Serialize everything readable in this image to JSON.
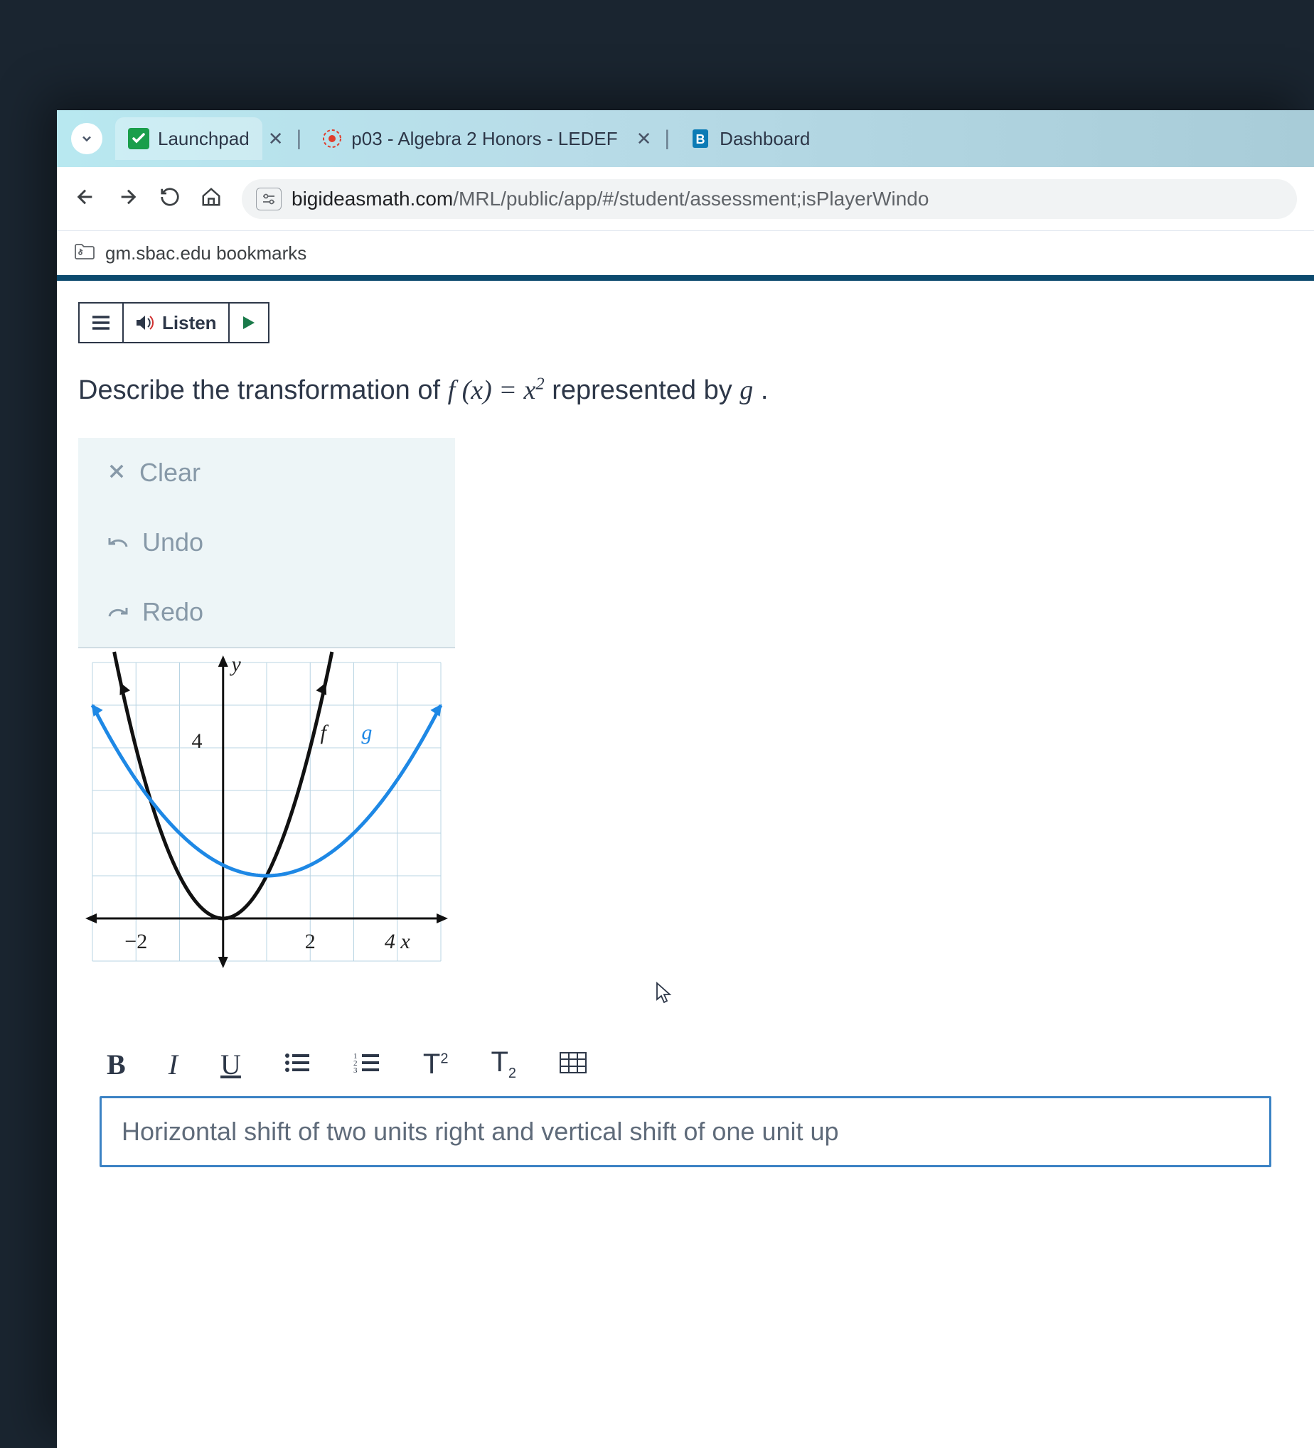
{
  "tabs": [
    {
      "title": "Launchpad",
      "favicon": "check-green"
    },
    {
      "title": "p03 - Algebra 2 Honors - LEDEF",
      "favicon": "canvas-red"
    },
    {
      "title": "Dashboard",
      "favicon": "bigideas-blue"
    }
  ],
  "url": {
    "host": "bigideasmath.com",
    "path": "/MRL/public/app/#/student/assessment;isPlayerWindo"
  },
  "bookmark": "gm.sbac.edu bookmarks",
  "listen_label": "Listen",
  "question": {
    "prefix": "Describe the transformation of ",
    "fx": "f (x) = x",
    "exp": "2",
    "mid": " represented by ",
    "g": "g",
    "suffix": " ."
  },
  "panel": {
    "clear": "Clear",
    "undo": "Undo",
    "redo": "Redo"
  },
  "chart_data": {
    "type": "line",
    "title": "",
    "xlabel": "x",
    "ylabel": "y",
    "xlim": [
      -3,
      5
    ],
    "ylim": [
      -1,
      6
    ],
    "x_ticks": [
      -2,
      2,
      4
    ],
    "y_ticks": [
      4
    ],
    "series": [
      {
        "name": "f",
        "color": "#111111",
        "formula": "x^2",
        "points": [
          {
            "x": -2.3,
            "y": 5.29
          },
          {
            "x": -2,
            "y": 4
          },
          {
            "x": -1,
            "y": 1
          },
          {
            "x": 0,
            "y": 0
          },
          {
            "x": 1,
            "y": 1
          },
          {
            "x": 2,
            "y": 4
          },
          {
            "x": 2.3,
            "y": 5.29
          }
        ]
      },
      {
        "name": "g",
        "color": "#1e88e5",
        "formula": "((x-1)/2)^2 + 1",
        "points": [
          {
            "x": -3,
            "y": 5
          },
          {
            "x": -2,
            "y": 3.25
          },
          {
            "x": -1,
            "y": 2
          },
          {
            "x": 0,
            "y": 1.25
          },
          {
            "x": 1,
            "y": 1
          },
          {
            "x": 2,
            "y": 1.25
          },
          {
            "x": 3,
            "y": 2
          },
          {
            "x": 4,
            "y": 3.25
          },
          {
            "x": 5,
            "y": 5
          }
        ]
      }
    ],
    "labels": [
      {
        "text": "y",
        "x": 0.3,
        "y": 5.8
      },
      {
        "text": "4",
        "x": -0.6,
        "y": 4
      },
      {
        "text": "f",
        "x": 2.3,
        "y": 4.2
      },
      {
        "text": "g",
        "x": 3.3,
        "y": 4.2
      },
      {
        "text": "-2",
        "x": -2,
        "y": -0.7
      },
      {
        "text": "2",
        "x": 2,
        "y": -0.7
      },
      {
        "text": "4 x",
        "x": 4,
        "y": -0.7
      }
    ]
  },
  "toolbar": {
    "bold": "B",
    "italic": "I",
    "underline": "U",
    "sup": "T",
    "sup_exp": "2",
    "sub": "T",
    "sub_sub": "2"
  },
  "answer_text": "Horizontal shift of two units right and vertical shift of one unit up"
}
